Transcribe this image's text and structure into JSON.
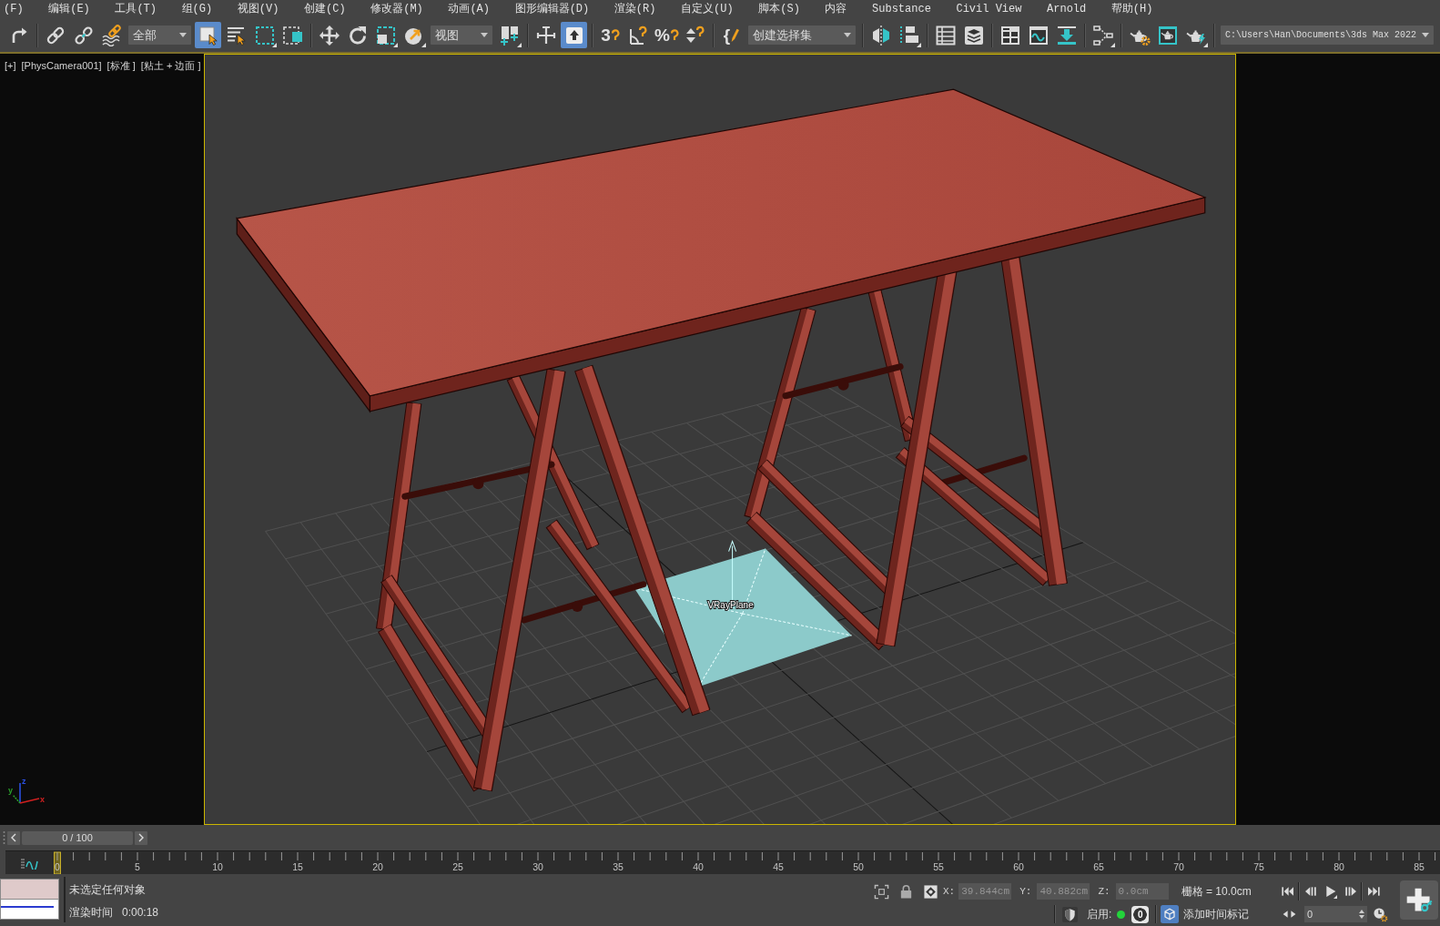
{
  "menu": [
    "(F)",
    "编辑(E)",
    "工具(T)",
    "组(G)",
    "视图(V)",
    "创建(C)",
    "修改器(M)",
    "动画(A)",
    "图形编辑器(D)",
    "渲染(R)",
    "自定义(U)",
    "脚本(S)",
    "内容",
    "Substance",
    "Civil View",
    "Arnold",
    "帮助(H)"
  ],
  "toolbar": [
    {
      "kind": "button",
      "selected": false,
      "flyout": false
    },
    {
      "kind": "separator"
    },
    {
      "kind": "button",
      "selected": false,
      "flyout": false
    },
    {
      "kind": "button",
      "selected": false,
      "flyout": false
    },
    {
      "kind": "button",
      "selected": false,
      "flyout": false
    },
    {
      "kind": "dropdown",
      "value": "全部"
    },
    {
      "kind": "button",
      "selected": true,
      "flyout": false
    },
    {
      "kind": "button",
      "selected": false,
      "flyout": false
    },
    {
      "kind": "button",
      "selected": false,
      "flyout": true
    },
    {
      "kind": "button",
      "selected": false,
      "flyout": false
    },
    {
      "kind": "separator"
    },
    {
      "kind": "button",
      "selected": false,
      "flyout": false
    },
    {
      "kind": "button",
      "selected": false,
      "flyout": false
    },
    {
      "kind": "button",
      "selected": false,
      "flyout": true
    },
    {
      "kind": "button",
      "selected": false,
      "flyout": true
    },
    {
      "kind": "dropdown",
      "value": "视图"
    },
    {
      "kind": "button",
      "selected": false,
      "flyout": true
    },
    {
      "kind": "separator"
    },
    {
      "kind": "button",
      "selected": false,
      "flyout": false
    },
    {
      "kind": "button",
      "selected": true,
      "flyout": false
    },
    {
      "kind": "separator"
    },
    {
      "kind": "button",
      "selected": false,
      "flyout": false,
      "glyph": "3"
    },
    {
      "kind": "button",
      "selected": false,
      "flyout": false
    },
    {
      "kind": "button",
      "selected": false,
      "flyout": false,
      "glyph": "%"
    },
    {
      "kind": "button",
      "selected": false,
      "flyout": false
    },
    {
      "kind": "separator"
    },
    {
      "kind": "button",
      "selected": false,
      "flyout": false,
      "glyph": "{"
    },
    {
      "kind": "dropdown",
      "value": "创建选择集"
    },
    {
      "kind": "separator"
    },
    {
      "kind": "button",
      "selected": false,
      "flyout": false
    },
    {
      "kind": "button",
      "selected": false,
      "flyout": true
    },
    {
      "kind": "separator"
    },
    {
      "kind": "button",
      "selected": false,
      "flyout": false
    },
    {
      "kind": "button",
      "selected": false,
      "flyout": false
    },
    {
      "kind": "separator"
    },
    {
      "kind": "button",
      "selected": false,
      "flyout": false
    },
    {
      "kind": "button",
      "selected": false,
      "flyout": false
    },
    {
      "kind": "button",
      "selected": false,
      "flyout": false
    },
    {
      "kind": "separator"
    },
    {
      "kind": "button",
      "selected": false,
      "flyout": true
    },
    {
      "kind": "separator"
    },
    {
      "kind": "button",
      "selected": false,
      "flyout": false
    },
    {
      "kind": "button",
      "selected": false,
      "flyout": false
    },
    {
      "kind": "button",
      "selected": false,
      "flyout": true
    },
    {
      "kind": "separator"
    },
    {
      "kind": "dropdown",
      "value": "C:\\Users\\Han\\Documents\\3ds Max 2022"
    }
  ],
  "viewport": {
    "labels": [
      "[+]",
      "[PhysCamera001]",
      "[标准 ]",
      "[粘土 + 边面 ]"
    ],
    "object_label": "VRayPlane",
    "axis_labels": [
      "z",
      "y",
      "x"
    ]
  },
  "time_slider": {
    "position": "0 / 100",
    "level": 0
  },
  "track_bar": {
    "frame_labels": [
      "0",
      "5",
      "10",
      "15",
      "20",
      "25",
      "30",
      "35",
      "40",
      "45",
      "50",
      "55",
      "60",
      "65",
      "70",
      "75",
      "80",
      "85"
    ]
  },
  "status_bar": {
    "prompt": "未选定任何对象",
    "render_time_label": "渲染时间",
    "render_time": "0:00:18",
    "coordinates": [
      {
        "axis": "X:",
        "value": "39.844cm",
        "disabled": true
      },
      {
        "axis": "Y:",
        "value": "40.882cm",
        "disabled": true
      },
      {
        "axis": "Z:",
        "value": "0.0cm",
        "disabled": true
      }
    ],
    "grid": "栅格 = 10.0cm",
    "enable_label": "启用:",
    "enabled": true,
    "count": "0",
    "time_tag": "添加时间标记",
    "current_frame": "0"
  }
}
